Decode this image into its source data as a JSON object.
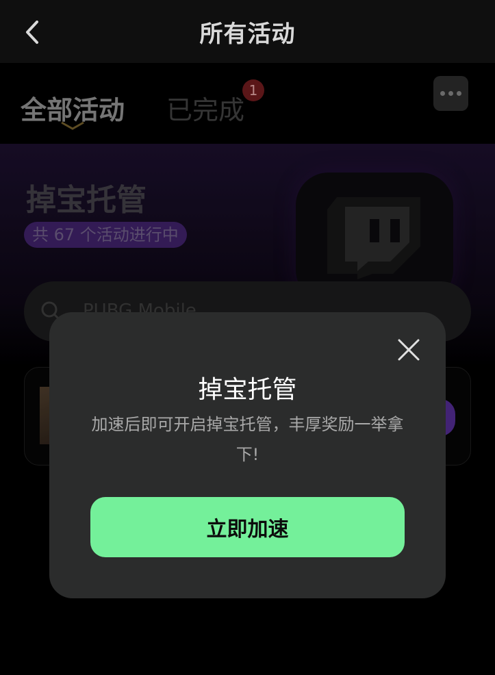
{
  "header": {
    "title": "所有活动",
    "back_icon": "chevron-left-icon"
  },
  "tabs": [
    {
      "label": "全部活动",
      "active": true
    },
    {
      "label": "已完成",
      "active": false,
      "badge": "1"
    }
  ],
  "more_icon": "more-dots-icon",
  "banner": {
    "title": "掉宝托管",
    "count_text": "共 67 个活动进行中",
    "logo_icon": "twitch-logo-icon"
  },
  "search": {
    "icon": "search-icon",
    "placeholder": "PUBG Mobile"
  },
  "modal": {
    "title": "掉宝托管",
    "description": "加速后即可开启掉宝托管，丰厚奖励一举拿下!",
    "button_label": "立即加速",
    "close_icon": "close-icon"
  },
  "colors": {
    "accent_green": "#74f09a",
    "modal_bg": "#2b2c2c",
    "badge_red": "#6a1a1d",
    "pill_purple": "#3c2064"
  }
}
